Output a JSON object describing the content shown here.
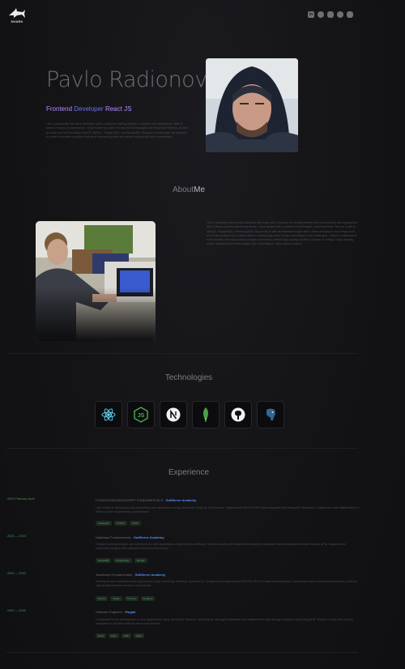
{
  "header": {
    "logo_text": "SHARK",
    "socials": [
      "linkedin-icon",
      "github-icon",
      "instagram-icon",
      "telegram-icon",
      "discord-icon"
    ]
  },
  "hero": {
    "name": "Pavlo Radionov",
    "role_a": "Frontend",
    "role_b": " Developer ",
    "role_c": "React JS",
    "description": "I am a passionate full-stack developer with a knack for crafting intuitive & reliable web applications. With 3 years of hands-on experience, I have honed my skills in front-end technologies like React and Node.js, as well as back-end tech including NestJS, MySQL, PostgreSQL, and MongoDB. My goal is to leverage my expertise to create innovative solutions that drive business growth and deliver exceptional user experiences."
  },
  "about": {
    "title_a": "About",
    "title_b": "Me",
    "text": "I am a dedicated and versatile full-stack developer with a passion for creating efficient and user-friendly web applications. With 3 years of professional experience, I have worked with a variety of technologies, including React, Next.js, Node.js, MySQL, PostgreSQL, and MongoDB. My journey in web development began with a deep curiosity for how things work, and it has evolved into a career where I continuously strive to learn and adapt to new challenges. I thrive in collaborative environments and enjoy solving complex problems to deliver high-quality solutions. Outside of coding, I enjoy staying active, exploring new technologies, and contributing to open-source projects."
  },
  "technologies": {
    "title": "Technologies",
    "items": [
      "react-icon",
      "nodejs-icon",
      "nextjs-icon",
      "mongodb-icon",
      "github-icon",
      "postgresql-icon"
    ]
  },
  "experience": {
    "title": "Experience",
    "entries": [
      {
        "date": "2023 February-April",
        "title": "HTML5/CSS3/JAVASCRIPT FUNDAMENTALS - ",
        "org": "SoftServe Academy",
        "desc": "I am a team in developing and maintaining web applications using JavaScript, React.js, and Node.js. Implemented RESTful APIs and integrated with MongoDB databases. Collaborated with stakeholders to define project requirements and timelines.",
        "chips": [
          "JavaScript",
          "HTML5",
          "CSS3"
        ]
      },
      {
        "date": "2023 — 2023",
        "title": "Database Fundamentals - ",
        "org": "SoftServe Academy",
        "desc": "Designed and developed user interfaces for web applications using Next.js and React. Worked closely with backend developers to integrate frontend components with Node.js APIs. Implemented responsive designs and optimized frontend performance.",
        "chips": [
          "MongoDB",
          "PostgreSQL",
          "MySQL"
        ]
      },
      {
        "date": "2020 — 2022",
        "title": "JavaScript Fundamentals - ",
        "org": "SoftServe Academy",
        "desc": "Developed and maintained web applications using JavaScript, React.js, and Node.js. Designed and implemented RESTful APIs for data communication. Collaborated with cross-functional teams to deliver high-quality software products on schedule.",
        "chips": [
          "Python",
          "Svelte",
          "Three.js",
          "Postgres"
        ]
      },
      {
        "date": "2020 — 2021",
        "title": "Software Engineer - ",
        "org": "Paypal",
        "desc": "Contributed to the development of web applications using JavaScript, React.js, and Node.js. Managed databases and implemented data storage solutions using MongoDB. Worked closely with product managers to prioritize features and enhancements.",
        "chips": [
          "Ruby",
          "Rails",
          "PHP",
          "Sqlite"
        ]
      }
    ]
  },
  "colors": {
    "accent_green": "#3d9e5a",
    "accent_blue": "#5a8fff",
    "accent_purple": "#b38cff"
  }
}
